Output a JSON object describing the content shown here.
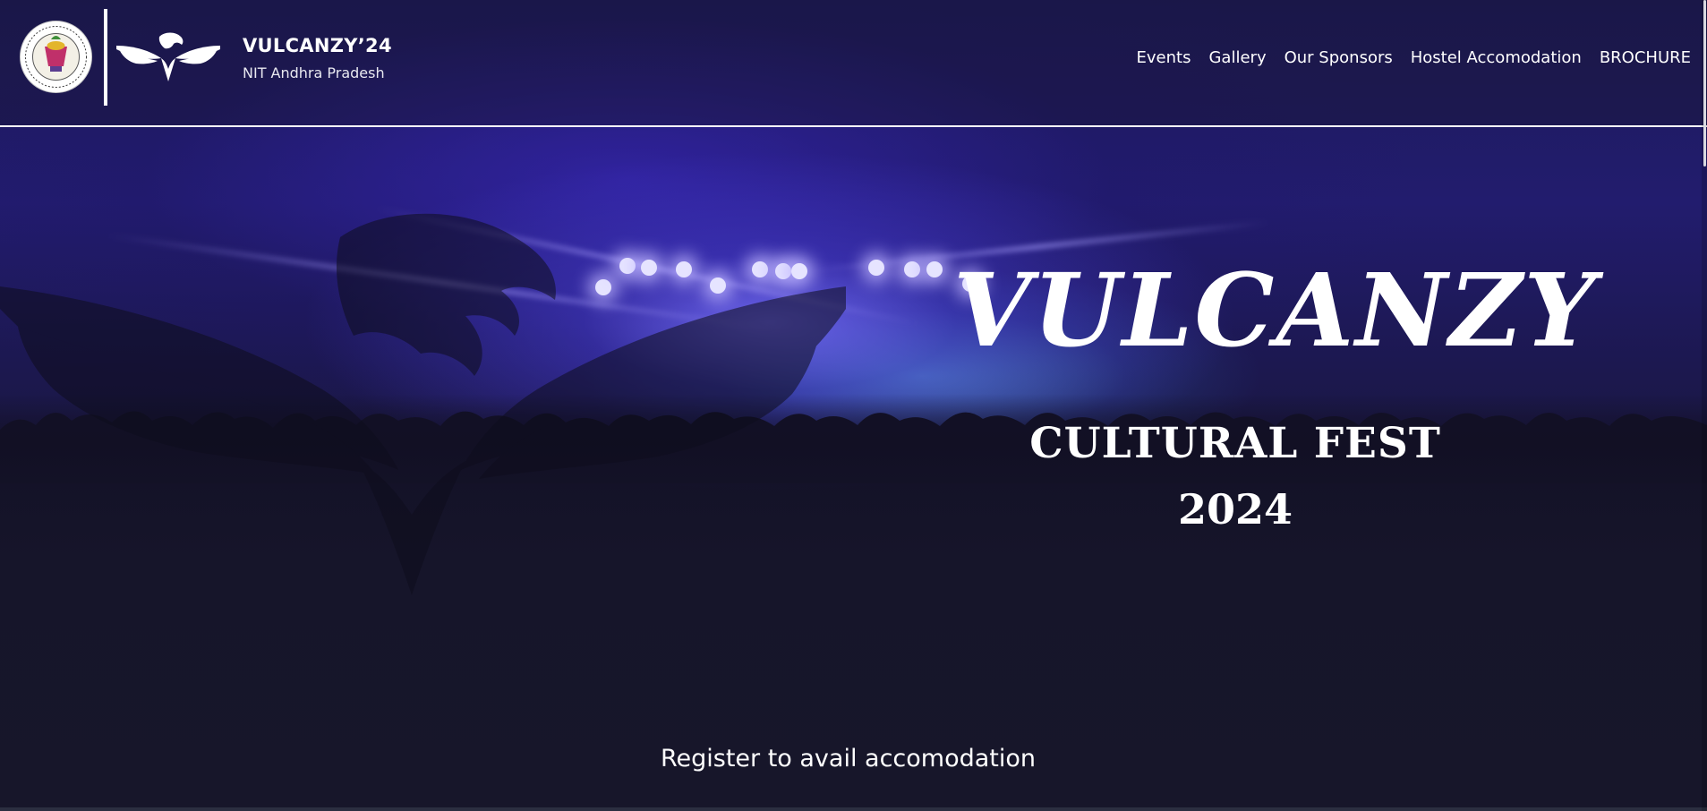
{
  "header": {
    "brand_title": "VULCANZY’24",
    "brand_subtitle": "NIT Andhra Pradesh",
    "nav": [
      {
        "label": "Events"
      },
      {
        "label": "Gallery"
      },
      {
        "label": "Our Sponsors"
      },
      {
        "label": "Hostel Accomodation"
      },
      {
        "label": "BROCHURE"
      }
    ]
  },
  "hero": {
    "title": "VULCANZY",
    "subtitle": "CULTURAL FEST",
    "year": "2024",
    "register_link": "Register to avail accomodation"
  },
  "icons": {
    "college_logo": "nit-andhra-pradesh-emblem-icon",
    "fest_logo": "eagle-logo-icon",
    "watermark": "eagle-watermark-icon"
  },
  "colors": {
    "background": "#17162a",
    "hero_glow": "#5a4fe0",
    "text": "#ffffff"
  }
}
